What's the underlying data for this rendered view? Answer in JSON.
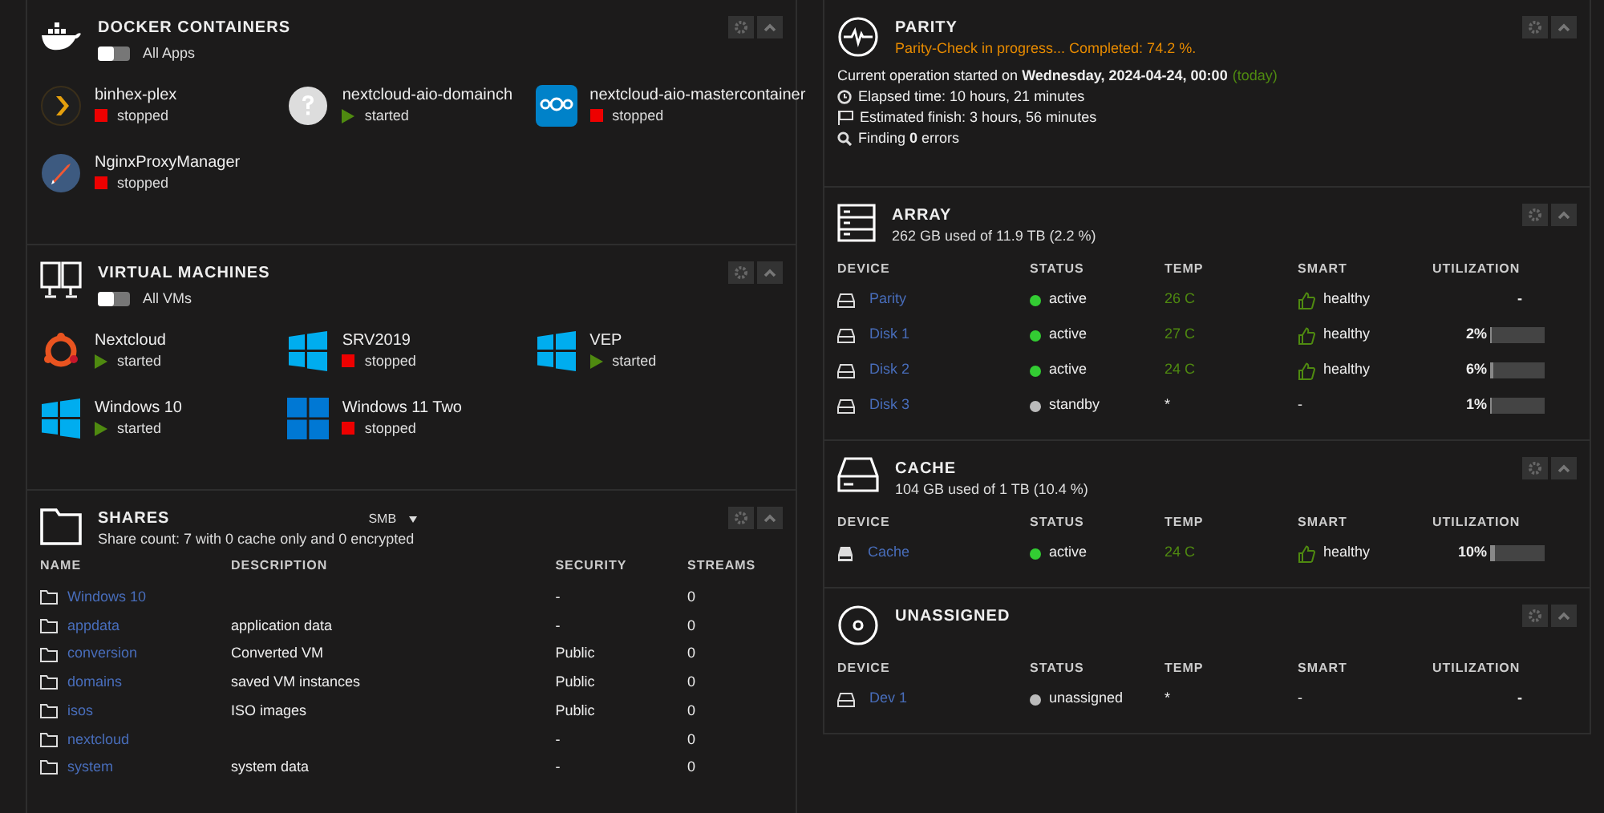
{
  "docker": {
    "title": "DOCKER CONTAINERS",
    "toggle": {
      "label": "All Apps",
      "on": false
    },
    "items": [
      {
        "name": "binhex-plex",
        "status": "stopped",
        "running": false,
        "kind": "plex"
      },
      {
        "name": "nextcloud-aio-domainch",
        "status": "started",
        "running": true,
        "kind": "unknown"
      },
      {
        "name": "nextcloud-aio-mastercontainer",
        "status": "stopped",
        "running": false,
        "kind": "nextcloud"
      },
      {
        "name": "NginxProxyManager",
        "status": "stopped",
        "running": false,
        "kind": "rocket"
      }
    ]
  },
  "vms": {
    "title": "VIRTUAL MACHINES",
    "toggle": {
      "label": "All VMs",
      "on": false
    },
    "items": [
      {
        "name": "Nextcloud",
        "status": "started",
        "running": true,
        "kind": "ubuntu"
      },
      {
        "name": "SRV2019",
        "status": "stopped",
        "running": false,
        "kind": "windows"
      },
      {
        "name": "VEP",
        "status": "started",
        "running": true,
        "kind": "windows"
      },
      {
        "name": "Windows 10",
        "status": "started",
        "running": true,
        "kind": "windows"
      },
      {
        "name": "Windows 11 Two",
        "status": "stopped",
        "running": false,
        "kind": "windows11"
      }
    ]
  },
  "shares": {
    "title": "SHARES",
    "protocol": "SMB",
    "summary": "Share count: 7 with 0 cache only and 0 encrypted",
    "columns": [
      "NAME",
      "DESCRIPTION",
      "SECURITY",
      "STREAMS"
    ],
    "rows": [
      {
        "name": "Windows 10",
        "security": "-",
        "streams": "0"
      },
      {
        "name": "appdata",
        "description": "application data",
        "security": "-",
        "streams": "0"
      },
      {
        "name": "conversion",
        "description": "Converted VM",
        "security": "Public",
        "streams": "0"
      },
      {
        "name": "domains",
        "description": "saved VM instances",
        "security": "Public",
        "streams": "0"
      },
      {
        "name": "isos",
        "description": "ISO images",
        "security": "Public",
        "streams": "0"
      },
      {
        "name": "nextcloud",
        "security": "-",
        "streams": "0"
      },
      {
        "name": "system",
        "description": "system data",
        "security": "-",
        "streams": "0"
      }
    ]
  },
  "parity": {
    "title": "PARITY",
    "status": "Parity-Check in progress... Completed: 74.2 %.",
    "started": "Current operation started on **Wednesday, 2024-04-24, 00:00**",
    "started_note": "(today)",
    "lines": [
      {
        "kind": "clock",
        "text": "Elapsed time: 10 hours, 21 minutes"
      },
      {
        "kind": "flag",
        "text": "Estimated finish: 3 hours, 56 minutes"
      },
      {
        "kind": "search",
        "text": "Finding **0** errors"
      }
    ]
  },
  "pools": [
    {
      "title": "ARRAY",
      "kind": "array",
      "summary": "262 GB used of 11.9 TB (2.2 %)",
      "columns": [
        "DEVICE",
        "STATUS",
        "TEMP",
        "SMART",
        "UTILIZATION"
      ],
      "rows": [
        {
          "device": "Parity",
          "kind": "hdd",
          "status": "active",
          "spinning": true,
          "temp": "26 C",
          "smart": "healthy",
          "smart_ok": true,
          "utilization": "-"
        },
        {
          "device": "Disk 1",
          "kind": "hdd",
          "status": "active",
          "spinning": true,
          "temp": "27 C",
          "smart": "healthy",
          "smart_ok": true,
          "utilization": "2%",
          "level": 0.02
        },
        {
          "device": "Disk 2",
          "kind": "hdd",
          "status": "active",
          "spinning": true,
          "temp": "24 C",
          "smart": "healthy",
          "smart_ok": true,
          "utilization": "6%",
          "level": 0.06
        },
        {
          "device": "Disk 3",
          "kind": "hdd",
          "status": "standby",
          "spinning": false,
          "temp": "*",
          "smart": "-",
          "smart_ok": false,
          "utilization": "1%",
          "level": 0.01
        }
      ]
    },
    {
      "title": "CACHE",
      "kind": "cache",
      "summary": "104 GB used of 1 TB (10.4 %)",
      "columns": [
        "DEVICE",
        "STATUS",
        "TEMP",
        "SMART",
        "UTILIZATION"
      ],
      "rows": [
        {
          "device": "Cache",
          "kind": "ssd",
          "status": "active",
          "spinning": true,
          "temp": "24 C",
          "smart": "healthy",
          "smart_ok": true,
          "utilization": "10%",
          "level": 0.1
        }
      ]
    },
    {
      "title": "UNASSIGNED",
      "kind": "disc",
      "columns": [
        "DEVICE",
        "STATUS",
        "TEMP",
        "SMART",
        "UTILIZATION"
      ],
      "rows": [
        {
          "device": "Dev 1",
          "kind": "hdd",
          "status": "unassigned",
          "spinning": false,
          "temp": "*",
          "smart": "-",
          "smart_ok": false,
          "utilization": "-"
        }
      ]
    }
  ]
}
